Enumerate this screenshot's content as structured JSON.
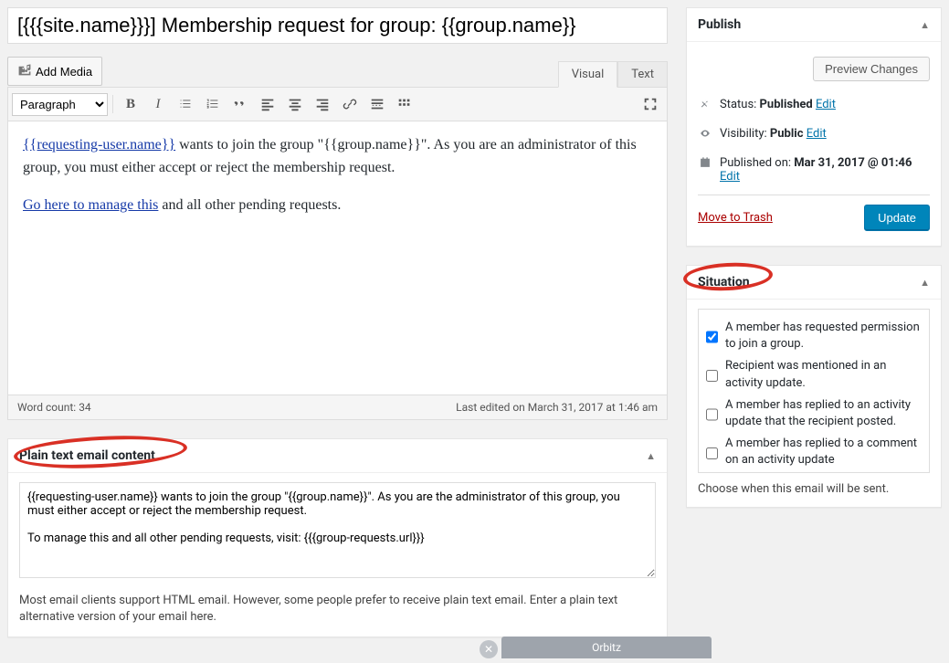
{
  "title": "[{{{site.name}}}] Membership request for group: {{group.name}}",
  "media_button": "Add Media",
  "tabs": {
    "visual": "Visual",
    "text": "Text"
  },
  "toolbar": {
    "format_select": "Paragraph"
  },
  "editor": {
    "link1": "{{requesting-user.name}}",
    "p1_tail": " wants to join the group \"{{group.name}}\". As you are an administrator of this group, you must either accept or reject the membership request.",
    "link2": "Go here to manage this",
    "p2_tail": " and all other pending requests."
  },
  "status": {
    "word_count_label": "Word count: ",
    "word_count": "34",
    "last_edited": "Last edited on March 31, 2017 at 1:46 am"
  },
  "plaintext": {
    "title": "Plain text email content",
    "value": "{{requesting-user.name}} wants to join the group \"{{group.name}}\". As you are the administrator of this group, you must either accept or reject the membership request.\n\nTo manage this and all other pending requests, visit: {{{group-requests.url}}}",
    "help": "Most email clients support HTML email. However, some people prefer to receive plain text email. Enter a plain text alternative version of your email here."
  },
  "publish": {
    "title": "Publish",
    "preview": "Preview Changes",
    "status_label": "Status: ",
    "status_value": "Published",
    "visibility_label": "Visibility: ",
    "visibility_value": "Public",
    "published_label": "Published on: ",
    "published_value": "Mar 31, 2017 @ 01:46",
    "edit": "Edit",
    "trash": "Move to Trash",
    "update": "Update"
  },
  "situation": {
    "title": "Situation",
    "items": [
      {
        "label": "A member has requested permission to join a group.",
        "checked": true
      },
      {
        "label": "Recipient was mentioned in an activity update.",
        "checked": false
      },
      {
        "label": "A member has replied to an activity update that the recipient posted.",
        "checked": false
      },
      {
        "label": "A member has replied to a comment on an activity update",
        "checked": false
      }
    ],
    "help": "Choose when this email will be sent."
  },
  "ad": {
    "label": "Orbitz"
  }
}
